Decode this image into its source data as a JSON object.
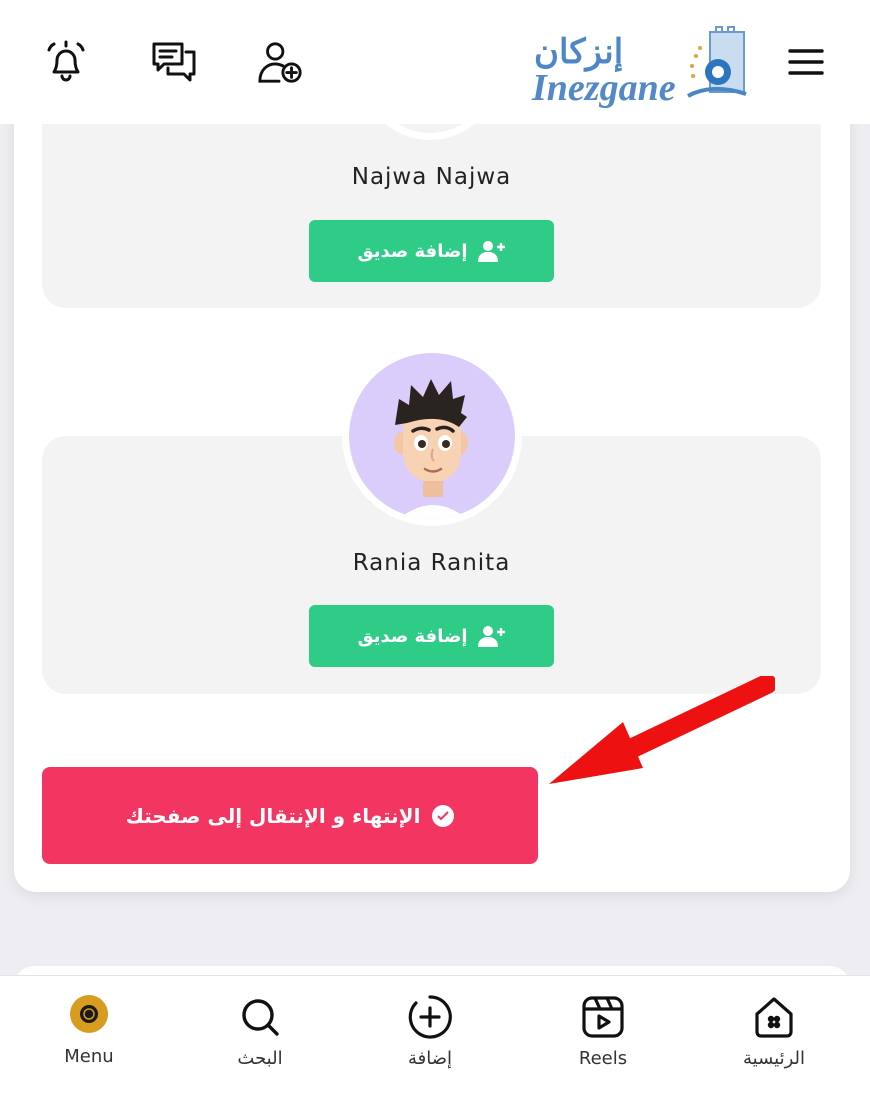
{
  "header": {
    "logo_arabic": "إنزكان",
    "logo_latin": "Inezgane",
    "icons": [
      "bell-icon",
      "chat-icon",
      "add-user-icon",
      "hamburger-menu-icon"
    ]
  },
  "friends": [
    {
      "name": "Najwa Najwa",
      "button_label": "إضافة صديق"
    },
    {
      "name": "Rania Ranita",
      "button_label": "إضافة صديق"
    }
  ],
  "finish_button": {
    "label": "الإنتهاء و الإنتقال إلى صفحتك"
  },
  "bottom_nav": {
    "items": [
      {
        "label": "Menu",
        "icon": "avatar"
      },
      {
        "label": "البحث",
        "icon": "search-icon"
      },
      {
        "label": "إضافة",
        "icon": "plus-circle-icon"
      },
      {
        "label": "Reels",
        "icon": "reels-icon"
      },
      {
        "label": "الرئيسية",
        "icon": "home-icon"
      }
    ]
  },
  "colors": {
    "accent_green": "#2ecc87",
    "accent_red": "#f33561",
    "avatar_bg": "#dacdfc",
    "arrow_red": "#ee1111"
  }
}
